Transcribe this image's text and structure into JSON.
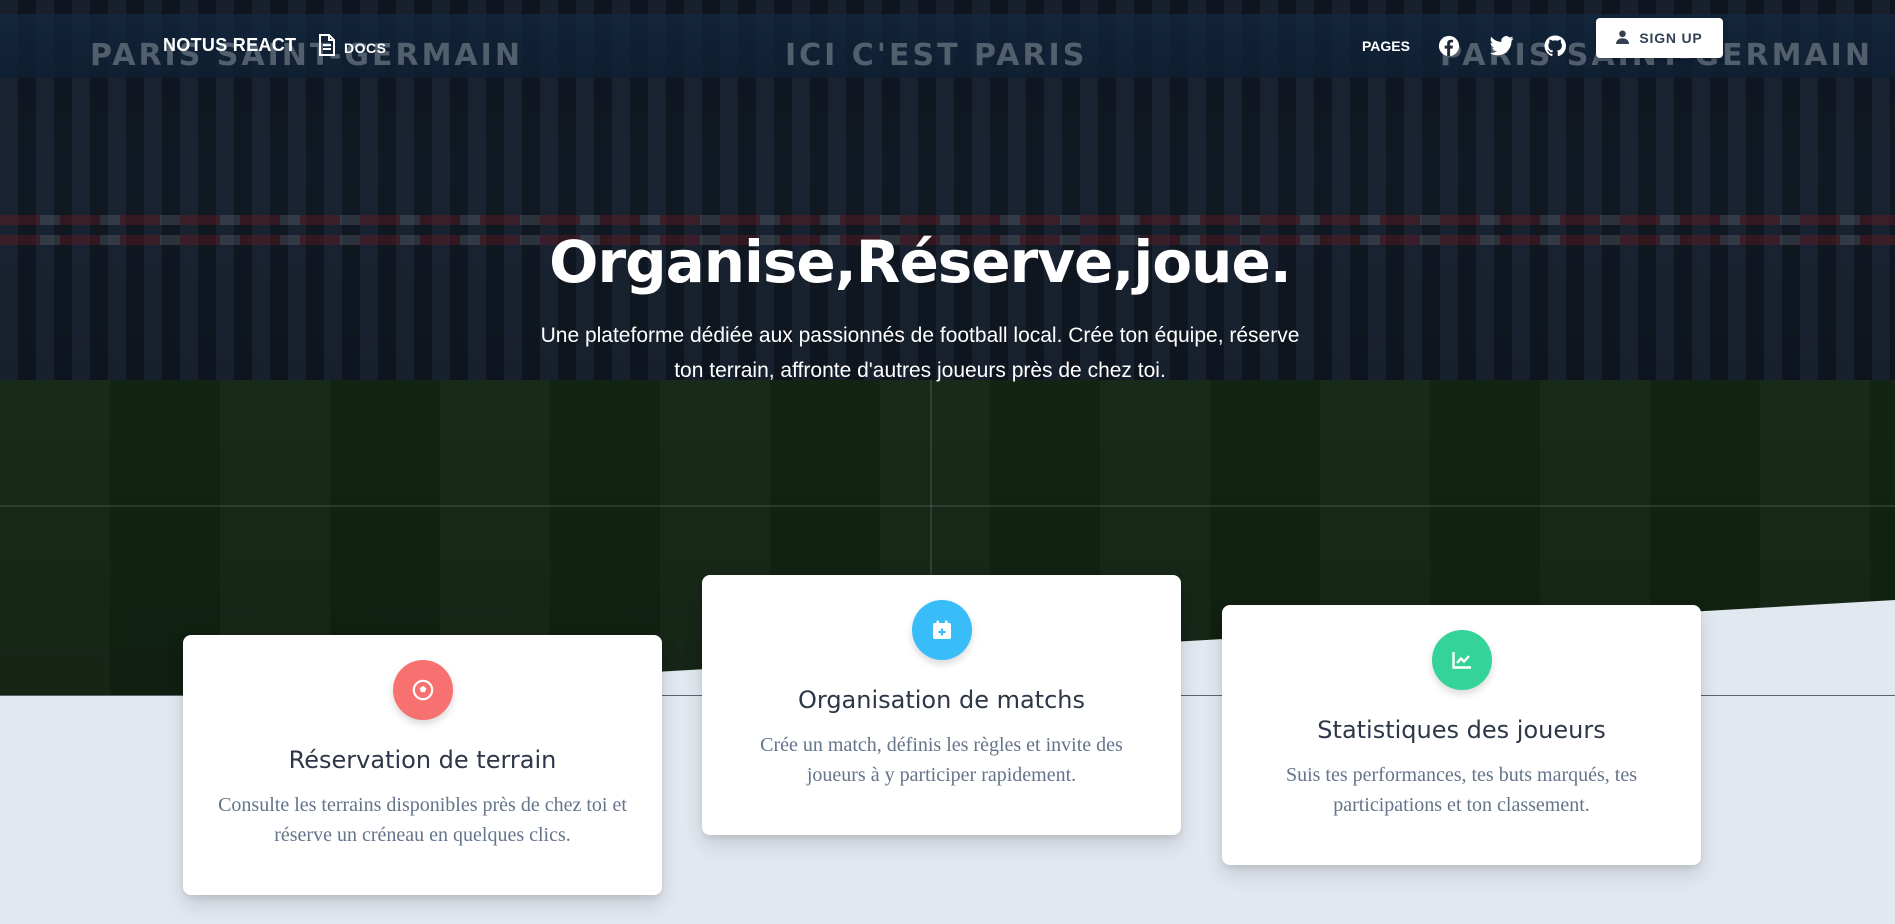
{
  "navbar": {
    "brand": "NOTUS REACT",
    "docs_label": "DOCS",
    "pages_label": "PAGES",
    "social_icons": [
      "facebook-icon",
      "twitter-icon",
      "github-icon"
    ],
    "signup_label": "SIGN UP"
  },
  "hero": {
    "background_banners": [
      "PARIS SAINT-GERMAIN",
      "ICI C'EST PARIS",
      "PARIS SAINT-GERMAIN"
    ],
    "title": "Organise,Réserve,joue.",
    "subtitle": "Une plateforme dédiée aux passionnés de football local. Crée ton équipe, réserve ton terrain, affronte d'autres joueurs près de chez toi."
  },
  "cards": [
    {
      "title": "Réservation de terrain",
      "description": "Consulte les terrains disponibles près de chez toi et réserve un créneau en quelques clics.",
      "icon": "football-icon",
      "color": "#f87171"
    },
    {
      "title": "Organisation de matchs",
      "description": "Crée un match, définis les règles et invite des joueurs à y participer rapidement.",
      "icon": "calendar-plus-icon",
      "color": "#38bdf8"
    },
    {
      "title": "Statistiques des joueurs",
      "description": "Suis tes performances, tes buts marqués, tes participations et ton classement.",
      "icon": "chart-line-icon",
      "color": "#34d399"
    }
  ]
}
